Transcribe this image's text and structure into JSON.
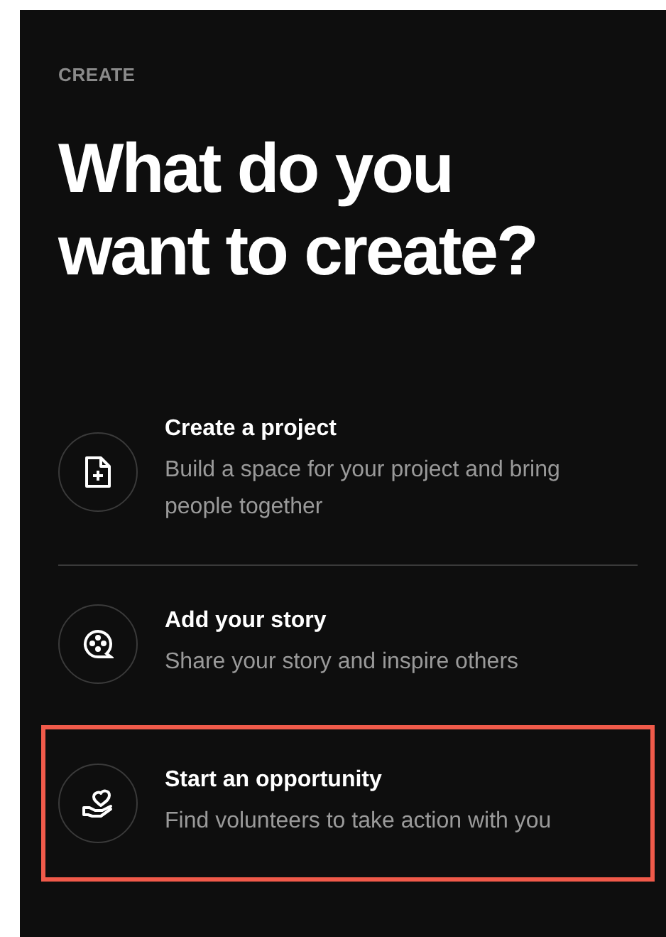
{
  "eyebrow": "CREATE",
  "heading": "What do you want to create?",
  "options": [
    {
      "kind": "document",
      "title": "Create a project",
      "description": "Build a space for your project and bring people together",
      "selected": false,
      "divider": true
    },
    {
      "kind": "reel",
      "title": "Add your story",
      "description": "Share your story and inspire others",
      "selected": false,
      "divider": false
    },
    {
      "kind": "hand-heart",
      "title": "Start an opportunity",
      "description": "Find volunteers to take action with you",
      "selected": true,
      "divider": false
    }
  ]
}
